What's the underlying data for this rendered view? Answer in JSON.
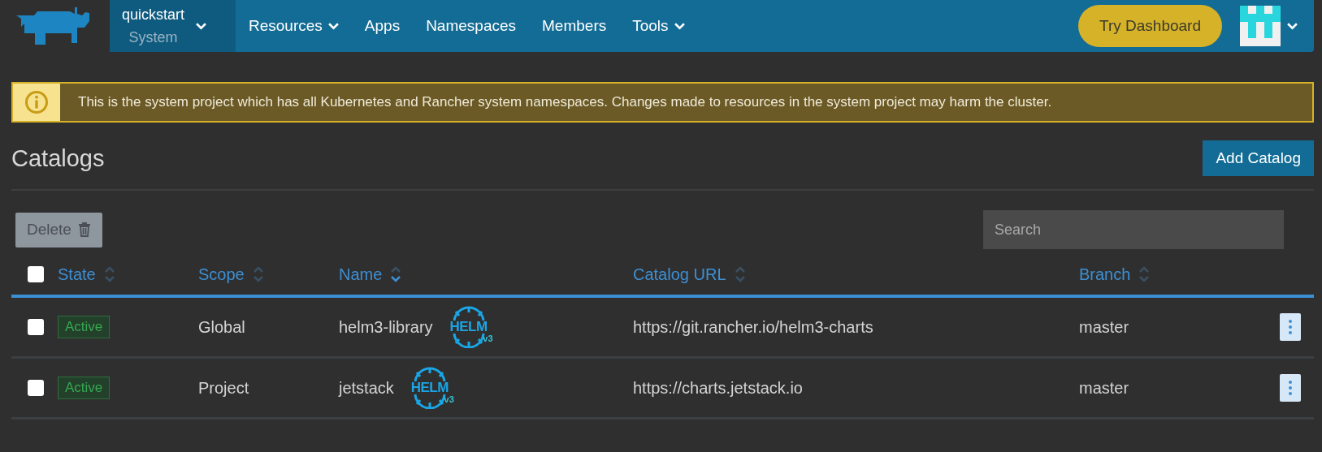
{
  "nav": {
    "project": {
      "name": "quickstart",
      "subtitle": "System"
    },
    "items": [
      {
        "label": "Resources",
        "dropdown": true
      },
      {
        "label": "Apps",
        "dropdown": false
      },
      {
        "label": "Namespaces",
        "dropdown": false
      },
      {
        "label": "Members",
        "dropdown": false
      },
      {
        "label": "Tools",
        "dropdown": true
      }
    ],
    "try_button": "Try Dashboard"
  },
  "banner": {
    "text": "This is the system project which has all Kubernetes and Rancher system namespaces. Changes made to resources in the system project may harm the cluster."
  },
  "page_title": "Catalogs",
  "add_button": "Add Catalog",
  "delete_button": {
    "label": "Delete",
    "disabled": true
  },
  "search": {
    "placeholder": "Search"
  },
  "table": {
    "select_all": {
      "checked": false
    },
    "columns": [
      {
        "label": "State",
        "sorted": false
      },
      {
        "label": "Scope",
        "sorted": false
      },
      {
        "label": "Name",
        "sorted": true
      },
      {
        "label": "Catalog URL",
        "sorted": false
      },
      {
        "label": "Branch",
        "sorted": false
      }
    ],
    "rows": [
      {
        "checked": false,
        "state": "Active",
        "scope": "Global",
        "name": "helm3-library",
        "badge": {
          "label": "HELM",
          "version": "v3"
        },
        "url": "https://git.rancher.io/helm3-charts",
        "branch": "master"
      },
      {
        "checked": false,
        "state": "Active",
        "scope": "Project",
        "name": "jetstack",
        "badge": {
          "label": "HELM",
          "version": "v3"
        },
        "url": "https://charts.jetstack.io",
        "branch": "master"
      }
    ]
  }
}
